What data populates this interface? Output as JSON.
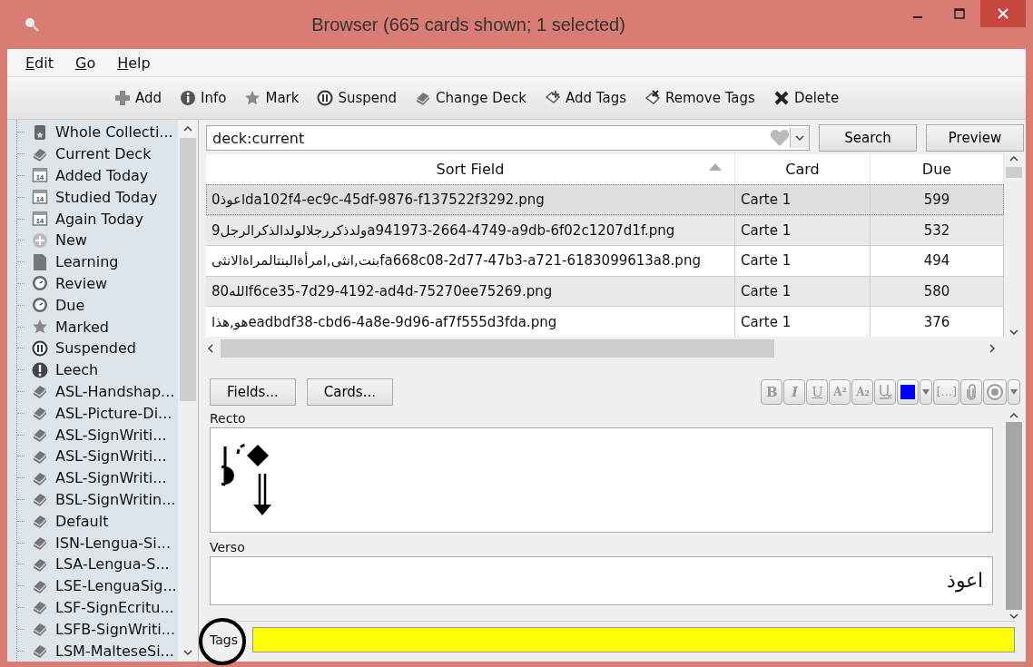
{
  "window": {
    "title": "Browser (665 cards shown; 1 selected)"
  },
  "menu": [
    "Edit",
    "Go",
    "Help"
  ],
  "toolbar": [
    {
      "label": "Add",
      "kind": "add"
    },
    {
      "label": "Info",
      "kind": "info"
    },
    {
      "label": "Mark",
      "kind": "star"
    },
    {
      "label": "Suspend",
      "kind": "pause"
    },
    {
      "label": "Change Deck",
      "kind": "deck"
    },
    {
      "label": "Add Tags",
      "kind": "tag"
    },
    {
      "label": "Remove Tags",
      "kind": "tagx"
    },
    {
      "label": "Delete",
      "kind": "delete"
    }
  ],
  "sidebar": {
    "items": [
      {
        "label": "Whole Collecti...",
        "kind": "collection"
      },
      {
        "label": "Current Deck",
        "kind": "deck"
      },
      {
        "label": "Added Today",
        "kind": "calendar",
        "badge": "14"
      },
      {
        "label": "Studied Today",
        "kind": "calendar",
        "badge": "14"
      },
      {
        "label": "Again Today",
        "kind": "calendar",
        "badge": "14"
      },
      {
        "label": "New",
        "kind": "plus"
      },
      {
        "label": "Learning",
        "kind": "page"
      },
      {
        "label": "Review",
        "kind": "clock"
      },
      {
        "label": "Due",
        "kind": "clock"
      },
      {
        "label": "Marked",
        "kind": "star"
      },
      {
        "label": "Suspended",
        "kind": "pause"
      },
      {
        "label": "Leech",
        "kind": "exclaim"
      },
      {
        "label": "ASL-Handshap...",
        "kind": "deck"
      },
      {
        "label": "ASL-Picture-Di...",
        "kind": "deck"
      },
      {
        "label": "ASL-SignWriti...",
        "kind": "deck"
      },
      {
        "label": "ASL-SignWriti...",
        "kind": "deck"
      },
      {
        "label": "ASL-SignWriti...",
        "kind": "deck"
      },
      {
        "label": "BSL-SignWritin...",
        "kind": "deck"
      },
      {
        "label": "Default",
        "kind": "deck"
      },
      {
        "label": "ISN-Lengua-Si...",
        "kind": "deck"
      },
      {
        "label": "LSA-Lengua-S...",
        "kind": "deck"
      },
      {
        "label": "LSE-LenguaSig...",
        "kind": "deck"
      },
      {
        "label": "LSF-SignEcritu...",
        "kind": "deck"
      },
      {
        "label": "LSFB-SignWriti...",
        "kind": "deck"
      },
      {
        "label": "LSM-MalteseSi...",
        "kind": "deck"
      }
    ]
  },
  "search": {
    "value": "deck:current",
    "buttons": [
      "Search",
      "Preview"
    ]
  },
  "table": {
    "columns": [
      "Sort Field",
      "Card",
      "Due"
    ],
    "rows": [
      {
        "cells": [
          "0اعوذda102f4-ec9c-45df-9876-f137522f3292.png",
          "Carte 1",
          "599"
        ],
        "selected": true
      },
      {
        "cells": [
          "9ولدذكررجلالولدالذكرالرجلa941973-2664-4749-a9db-6f02c1207d1f.png",
          "Carte 1",
          "532"
        ],
        "selected": false
      },
      {
        "cells": [
          "بنت,انثى,امرأةالبنتالمراةالانثىfa668c08-2d77-47b3-a721-6183099613a8.png",
          "Carte 1",
          "494"
        ],
        "selected": false
      },
      {
        "cells": [
          "80اللهf6ce35-7d29-4192-ad4d-75270ee75269.png",
          "Carte 1",
          "580"
        ],
        "selected": false
      },
      {
        "cells": [
          "هو,هذاeadbdf38-cbd6-4a8e-9d96-af7f555d3fda.png",
          "Carte 1",
          "376"
        ],
        "selected": false
      }
    ]
  },
  "editor": {
    "buttons": [
      "Fields...",
      "Cards..."
    ],
    "format_buttons": [
      {
        "kind": "bold",
        "label": "B"
      },
      {
        "kind": "italic",
        "label": "I"
      },
      {
        "kind": "underline",
        "label": "U"
      },
      {
        "kind": "super",
        "label": "A²"
      },
      {
        "kind": "sub",
        "label": "A₂"
      },
      {
        "kind": "clear"
      },
      {
        "kind": "color",
        "color": "#0000ff"
      },
      {
        "kind": "dropdown"
      },
      {
        "kind": "cloze",
        "label": "[...]"
      },
      {
        "kind": "attach"
      },
      {
        "kind": "record"
      },
      {
        "kind": "dropdown"
      }
    ],
    "fields": [
      {
        "name": "Recto",
        "kind": "image"
      },
      {
        "name": "Verso",
        "kind": "text",
        "value": "اعوذ"
      }
    ],
    "tags": {
      "label": "Tags"
    }
  }
}
